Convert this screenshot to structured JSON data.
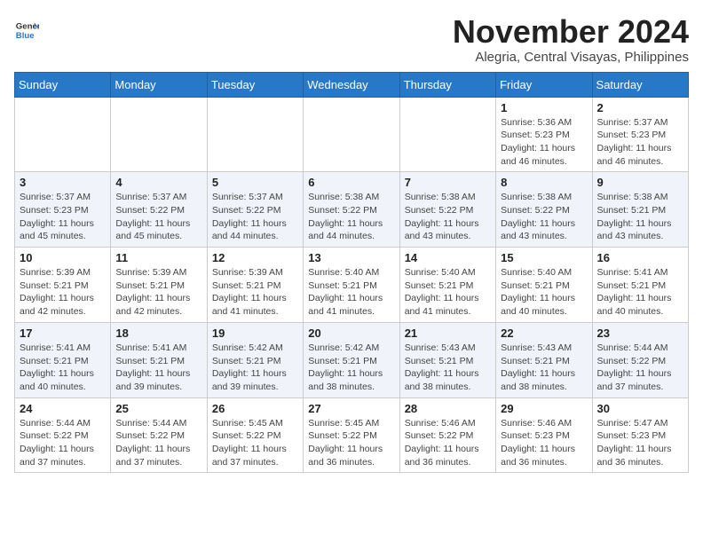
{
  "header": {
    "logo": {
      "general": "General",
      "blue": "Blue"
    },
    "month": "November 2024",
    "location": "Alegria, Central Visayas, Philippines"
  },
  "weekdays": [
    "Sunday",
    "Monday",
    "Tuesday",
    "Wednesday",
    "Thursday",
    "Friday",
    "Saturday"
  ],
  "weeks": [
    [
      {
        "day": "",
        "info": ""
      },
      {
        "day": "",
        "info": ""
      },
      {
        "day": "",
        "info": ""
      },
      {
        "day": "",
        "info": ""
      },
      {
        "day": "",
        "info": ""
      },
      {
        "day": "1",
        "info": "Sunrise: 5:36 AM\nSunset: 5:23 PM\nDaylight: 11 hours and 46 minutes."
      },
      {
        "day": "2",
        "info": "Sunrise: 5:37 AM\nSunset: 5:23 PM\nDaylight: 11 hours and 46 minutes."
      }
    ],
    [
      {
        "day": "3",
        "info": "Sunrise: 5:37 AM\nSunset: 5:23 PM\nDaylight: 11 hours and 45 minutes."
      },
      {
        "day": "4",
        "info": "Sunrise: 5:37 AM\nSunset: 5:22 PM\nDaylight: 11 hours and 45 minutes."
      },
      {
        "day": "5",
        "info": "Sunrise: 5:37 AM\nSunset: 5:22 PM\nDaylight: 11 hours and 44 minutes."
      },
      {
        "day": "6",
        "info": "Sunrise: 5:38 AM\nSunset: 5:22 PM\nDaylight: 11 hours and 44 minutes."
      },
      {
        "day": "7",
        "info": "Sunrise: 5:38 AM\nSunset: 5:22 PM\nDaylight: 11 hours and 43 minutes."
      },
      {
        "day": "8",
        "info": "Sunrise: 5:38 AM\nSunset: 5:22 PM\nDaylight: 11 hours and 43 minutes."
      },
      {
        "day": "9",
        "info": "Sunrise: 5:38 AM\nSunset: 5:21 PM\nDaylight: 11 hours and 43 minutes."
      }
    ],
    [
      {
        "day": "10",
        "info": "Sunrise: 5:39 AM\nSunset: 5:21 PM\nDaylight: 11 hours and 42 minutes."
      },
      {
        "day": "11",
        "info": "Sunrise: 5:39 AM\nSunset: 5:21 PM\nDaylight: 11 hours and 42 minutes."
      },
      {
        "day": "12",
        "info": "Sunrise: 5:39 AM\nSunset: 5:21 PM\nDaylight: 11 hours and 41 minutes."
      },
      {
        "day": "13",
        "info": "Sunrise: 5:40 AM\nSunset: 5:21 PM\nDaylight: 11 hours and 41 minutes."
      },
      {
        "day": "14",
        "info": "Sunrise: 5:40 AM\nSunset: 5:21 PM\nDaylight: 11 hours and 41 minutes."
      },
      {
        "day": "15",
        "info": "Sunrise: 5:40 AM\nSunset: 5:21 PM\nDaylight: 11 hours and 40 minutes."
      },
      {
        "day": "16",
        "info": "Sunrise: 5:41 AM\nSunset: 5:21 PM\nDaylight: 11 hours and 40 minutes."
      }
    ],
    [
      {
        "day": "17",
        "info": "Sunrise: 5:41 AM\nSunset: 5:21 PM\nDaylight: 11 hours and 40 minutes."
      },
      {
        "day": "18",
        "info": "Sunrise: 5:41 AM\nSunset: 5:21 PM\nDaylight: 11 hours and 39 minutes."
      },
      {
        "day": "19",
        "info": "Sunrise: 5:42 AM\nSunset: 5:21 PM\nDaylight: 11 hours and 39 minutes."
      },
      {
        "day": "20",
        "info": "Sunrise: 5:42 AM\nSunset: 5:21 PM\nDaylight: 11 hours and 38 minutes."
      },
      {
        "day": "21",
        "info": "Sunrise: 5:43 AM\nSunset: 5:21 PM\nDaylight: 11 hours and 38 minutes."
      },
      {
        "day": "22",
        "info": "Sunrise: 5:43 AM\nSunset: 5:21 PM\nDaylight: 11 hours and 38 minutes."
      },
      {
        "day": "23",
        "info": "Sunrise: 5:44 AM\nSunset: 5:22 PM\nDaylight: 11 hours and 37 minutes."
      }
    ],
    [
      {
        "day": "24",
        "info": "Sunrise: 5:44 AM\nSunset: 5:22 PM\nDaylight: 11 hours and 37 minutes."
      },
      {
        "day": "25",
        "info": "Sunrise: 5:44 AM\nSunset: 5:22 PM\nDaylight: 11 hours and 37 minutes."
      },
      {
        "day": "26",
        "info": "Sunrise: 5:45 AM\nSunset: 5:22 PM\nDaylight: 11 hours and 37 minutes."
      },
      {
        "day": "27",
        "info": "Sunrise: 5:45 AM\nSunset: 5:22 PM\nDaylight: 11 hours and 36 minutes."
      },
      {
        "day": "28",
        "info": "Sunrise: 5:46 AM\nSunset: 5:22 PM\nDaylight: 11 hours and 36 minutes."
      },
      {
        "day": "29",
        "info": "Sunrise: 5:46 AM\nSunset: 5:23 PM\nDaylight: 11 hours and 36 minutes."
      },
      {
        "day": "30",
        "info": "Sunrise: 5:47 AM\nSunset: 5:23 PM\nDaylight: 11 hours and 36 minutes."
      }
    ]
  ]
}
